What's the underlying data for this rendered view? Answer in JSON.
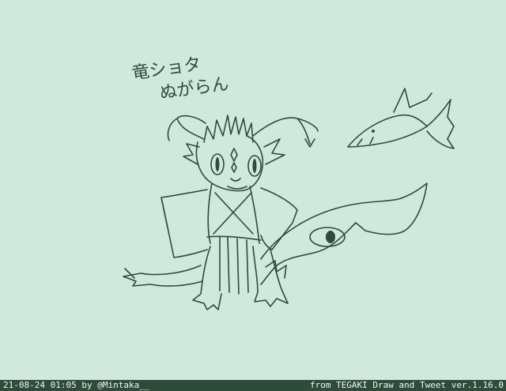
{
  "caption": {
    "line1": "竜ショタ",
    "line2": "ぬがらん"
  },
  "footer": {
    "left_text": "21-08-24 01:05 by @Mintaka__",
    "right_text": "from TEGAKI Draw and Tweet ver.1.16.0"
  },
  "colors": {
    "background": "#d1e9dd",
    "ink": "#2f4b3c",
    "footer_background": "#2f4b3c",
    "footer_text": "#f2f6f3"
  }
}
